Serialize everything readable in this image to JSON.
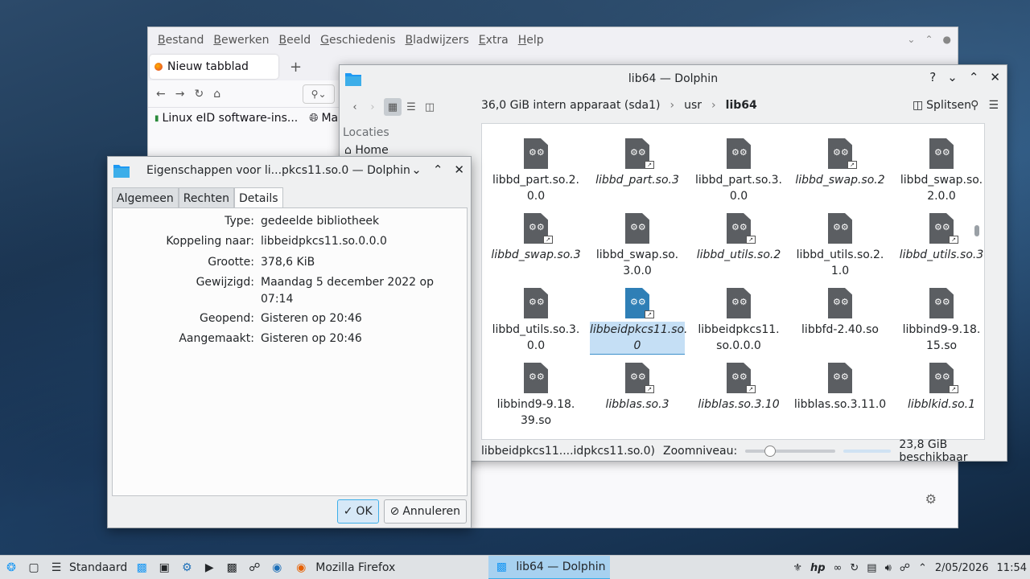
{
  "firefox": {
    "menu": [
      "Bestand",
      "Bewerken",
      "Beeld",
      "Geschiedenis",
      "Bladwijzers",
      "Extra",
      "Help"
    ],
    "tab_label": "Nieuw tabblad",
    "bookmarks": [
      "Linux eID software-ins...",
      "Ma"
    ]
  },
  "dolphin": {
    "title": "lib64 — Dolphin",
    "breadcrumb": [
      "36,0 GiB intern apparaat (sda1)",
      "usr",
      "lib64"
    ],
    "split_label": "Splitsen",
    "places_header": "Locaties",
    "places": [
      "Home"
    ],
    "files": [
      {
        "name": "libbd_part.so.2.\n0.0",
        "link": false
      },
      {
        "name": "libbd_part.so.3",
        "link": true
      },
      {
        "name": "libbd_part.so.3.\n0.0",
        "link": false
      },
      {
        "name": "libbd_swap.so.2",
        "link": true
      },
      {
        "name": "libbd_swap.so.\n2.0.0",
        "link": false
      },
      {
        "name": "libbd_swap.so.3",
        "link": true
      },
      {
        "name": "libbd_swap.so.\n3.0.0",
        "link": false
      },
      {
        "name": "libbd_utils.so.2",
        "link": true
      },
      {
        "name": "libbd_utils.so.2.\n1.0",
        "link": false
      },
      {
        "name": "libbd_utils.so.3",
        "link": true
      },
      {
        "name": "libbd_utils.so.3.\n0.0",
        "link": false
      },
      {
        "name": "libbeidpkcs11.so.\n0",
        "link": true,
        "selected": true
      },
      {
        "name": "libbeidpkcs11.\nso.0.0.0",
        "link": false
      },
      {
        "name": "libbfd-2.40.so",
        "link": false
      },
      {
        "name": "libbind9-9.18.\n15.so",
        "link": false
      },
      {
        "name": "libbind9-9.18.\n39.so",
        "link": false
      },
      {
        "name": "libblas.so.3",
        "link": true
      },
      {
        "name": "libblas.so.3.10",
        "link": true
      },
      {
        "name": "libblas.so.3.11.0",
        "link": false
      },
      {
        "name": "libblkid.so.1",
        "link": true
      }
    ],
    "status_text": "libbeidpkcs11....idpkcs11.so.0)",
    "zoom_label": "Zoomniveau:",
    "free_space": "23,8 GiB beschikbaar"
  },
  "properties": {
    "title": "Eigenschappen voor li...pkcs11.so.0 — Dolphin",
    "tabs": [
      "Algemeen",
      "Rechten",
      "Details"
    ],
    "rows": [
      {
        "key": "Type:",
        "value": "gedeelde bibliotheek"
      },
      {
        "key": "Koppeling naar:",
        "value": "libbeidpkcs11.so.0.0.0"
      },
      {
        "key": "Grootte:",
        "value": "378,6 KiB"
      },
      {
        "key": "Gewijzigd:",
        "value": "Maandag 5 december 2022 op 07:14"
      },
      {
        "key": "Geopend:",
        "value": "Gisteren op 20:46"
      },
      {
        "key": "Aangemaakt:",
        "value": "Gisteren op 20:46"
      }
    ],
    "ok_label": "OK",
    "cancel_label": "Annuleren"
  },
  "taskbar": {
    "desktop_label": "Standaard",
    "tasks": [
      "Mozilla Firefox",
      "lib64 — Dolphin"
    ],
    "date": "2/05/2026",
    "time": "11:54"
  }
}
